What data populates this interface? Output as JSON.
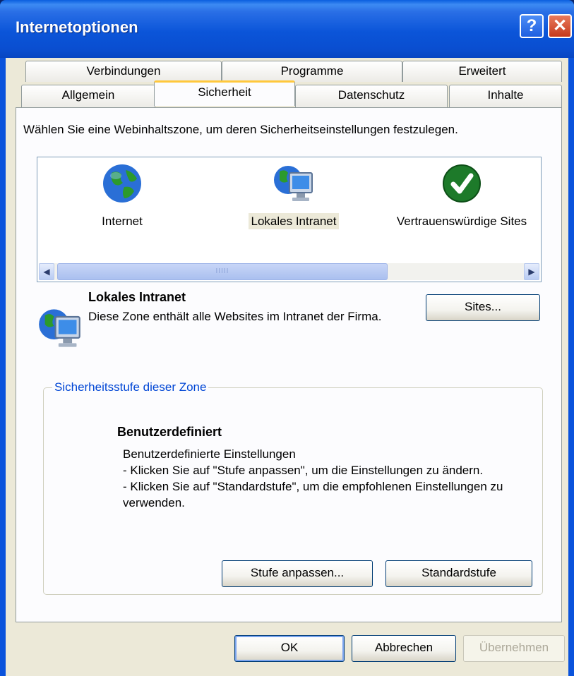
{
  "window": {
    "title": "Internetoptionen",
    "help_label": "?",
    "close_label": "✕"
  },
  "tabs": {
    "row_back": [
      {
        "label": "Verbindungen"
      },
      {
        "label": "Programme"
      },
      {
        "label": "Erweitert"
      }
    ],
    "row_front": [
      {
        "label": "Allgemein"
      },
      {
        "label": "Sicherheit",
        "active": true
      },
      {
        "label": "Datenschutz"
      },
      {
        "label": "Inhalte"
      }
    ]
  },
  "security": {
    "prompt": "Wählen Sie eine Webinhaltszone, um deren Sicherheitseinstellungen festzulegen.",
    "zones": [
      {
        "label": "Internet",
        "icon": "globe-icon"
      },
      {
        "label": "Lokales Intranet",
        "icon": "intranet-icon",
        "selected": true
      },
      {
        "label": "Vertrauenswürdige Sites",
        "icon": "checkmark-icon"
      }
    ],
    "scroll_left": "◀",
    "scroll_right": "▶",
    "scroll_grip": "IIIII",
    "selected_zone": {
      "title": "Lokales Intranet",
      "description": "Diese Zone enthält alle Websites im Intranet der Firma."
    },
    "sites_button": "Sites...",
    "level_group": {
      "legend": "Sicherheitsstufe dieser Zone",
      "level_title": "Benutzerdefiniert",
      "lines": [
        "Benutzerdefinierte Einstellungen",
        "- Klicken Sie auf \"Stufe anpassen\", um die Einstellungen zu ändern.",
        "- Klicken Sie auf \"Standardstufe\", um die empfohlenen Einstellungen zu verwenden."
      ],
      "custom_level_button": "Stufe anpassen...",
      "default_level_button": "Standardstufe"
    }
  },
  "footer": {
    "ok_button": "OK",
    "cancel_button": "Abbrechen",
    "apply_button": "Übernehmen",
    "apply_enabled": false
  },
  "colors": {
    "titlebar": "#0a55d9",
    "client_bg": "#ece9d8",
    "groupbox_legend": "#0046d5",
    "active_tab_highlight": "#ffc83c"
  }
}
